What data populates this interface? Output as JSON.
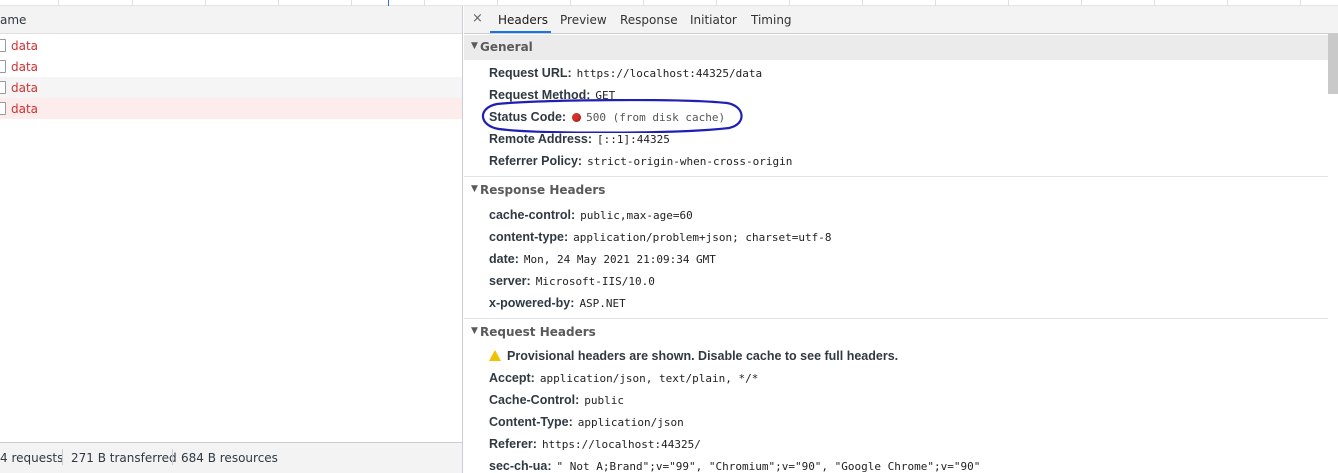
{
  "left_panel": {
    "column_header": "ame",
    "requests": [
      {
        "name": "data"
      },
      {
        "name": "data"
      },
      {
        "name": "data"
      },
      {
        "name": "data"
      }
    ],
    "summary": {
      "requests": "4 requests",
      "transferred": "271 B transferred",
      "resources": "684 B resources"
    }
  },
  "tabs": {
    "close": "×",
    "items": [
      "Headers",
      "Preview",
      "Response",
      "Initiator",
      "Timing"
    ],
    "active": "Headers"
  },
  "general": {
    "title": "General",
    "request_url_key": "Request URL:",
    "request_url_val": "https://localhost:44325/data",
    "request_method_key": "Request Method:",
    "request_method_val": "GET",
    "status_code_key": "Status Code:",
    "status_code_val": "500  (from disk cache)",
    "remote_address_key": "Remote Address:",
    "remote_address_val": "[::1]:44325",
    "referrer_policy_key": "Referrer Policy:",
    "referrer_policy_val": "strict-origin-when-cross-origin"
  },
  "response_headers": {
    "title": "Response Headers",
    "items": [
      {
        "k": "cache-control:",
        "v": "public,max-age=60"
      },
      {
        "k": "content-type:",
        "v": "application/problem+json; charset=utf-8"
      },
      {
        "k": "date:",
        "v": "Mon, 24 May 2021 21:09:34 GMT"
      },
      {
        "k": "server:",
        "v": "Microsoft-IIS/10.0"
      },
      {
        "k": "x-powered-by:",
        "v": "ASP.NET"
      }
    ]
  },
  "request_headers": {
    "title": "Request Headers",
    "warning": "Provisional headers are shown. Disable cache to see full headers.",
    "items": [
      {
        "k": "Accept:",
        "v": "application/json, text/plain, */*"
      },
      {
        "k": "Cache-Control:",
        "v": "public"
      },
      {
        "k": "Content-Type:",
        "v": "application/json"
      },
      {
        "k": "Referer:",
        "v": "https://localhost:44325/"
      },
      {
        "k": "sec-ch-ua:",
        "v": "\" Not A;Brand\";v=\"99\", \"Chromium\";v=\"90\", \"Google Chrome\";v=\"90\""
      }
    ]
  },
  "colors": {
    "error_text": "#d32f2f",
    "accent": "#1a73e8",
    "annotation": "#1f1fb4",
    "status_dot": "#d93025"
  },
  "icons": [
    "close-icon",
    "collapse-triangle-icon",
    "status-dot-icon",
    "warning-icon"
  ]
}
